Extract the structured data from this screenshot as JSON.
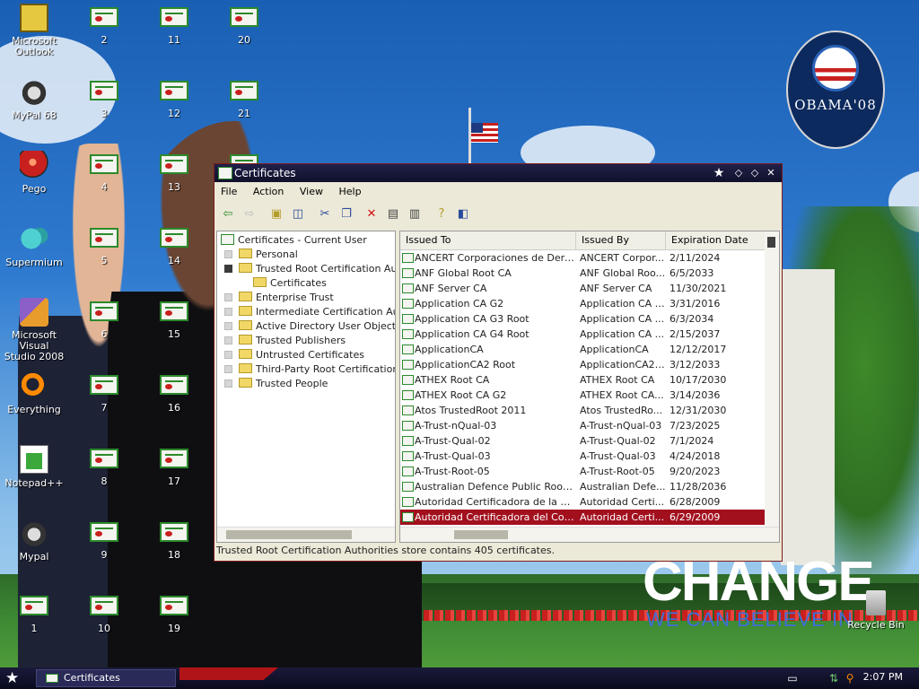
{
  "desktop": {
    "apps": [
      {
        "label": "Microsoft\nOutlook",
        "icon": "outlook-icon"
      },
      {
        "label": "MyPal 68",
        "icon": "raccoon-icon"
      },
      {
        "label": "Pego",
        "icon": "pego-icon"
      },
      {
        "label": "Supermium",
        "icon": "supermium-icon"
      },
      {
        "label": "Microsoft Visual\nStudio 2008",
        "icon": "visual-studio-icon"
      },
      {
        "label": "Everything",
        "icon": "search-icon"
      },
      {
        "label": "Notepad++",
        "icon": "notepad-icon"
      },
      {
        "label": "Mypal",
        "icon": "raccoon-icon"
      },
      {
        "label": "1",
        "icon": "certificate-icon"
      }
    ],
    "cert_icons": [
      "2",
      "3",
      "4",
      "5",
      "6",
      "7",
      "8",
      "9",
      "10",
      "11",
      "12",
      "13",
      "14",
      "15",
      "16",
      "17",
      "18",
      "19",
      "20",
      "21"
    ],
    "recycle_bin": "Recycle Bin",
    "wallpaper": {
      "logo_text": "OBAMA'08",
      "headline": "CHANGE",
      "tagline": "WE CAN BELIEVE IN"
    }
  },
  "window": {
    "title": "Certificates",
    "menu": [
      "File",
      "Action",
      "View",
      "Help"
    ],
    "toolbar_icons": [
      "back-icon",
      "forward-icon",
      "up-folder-icon",
      "show-hide-tree-icon",
      "cut-icon",
      "copy-icon",
      "delete-icon",
      "properties-icon",
      "export-icon",
      "help-icon",
      "console-icon"
    ],
    "tree": {
      "root": "Certificates - Current User",
      "items": [
        {
          "label": "Personal",
          "level": 1,
          "expander": "plus"
        },
        {
          "label": "Trusted Root Certification Authorities",
          "level": 1,
          "expander": "minus"
        },
        {
          "label": "Certificates",
          "level": 2,
          "expander": "none"
        },
        {
          "label": "Enterprise Trust",
          "level": 1,
          "expander": "plus"
        },
        {
          "label": "Intermediate Certification Authorities",
          "level": 1,
          "expander": "plus"
        },
        {
          "label": "Active Directory User Object",
          "level": 1,
          "expander": "plus"
        },
        {
          "label": "Trusted Publishers",
          "level": 1,
          "expander": "plus"
        },
        {
          "label": "Untrusted Certificates",
          "level": 1,
          "expander": "plus"
        },
        {
          "label": "Third-Party Root Certification Authorities",
          "level": 1,
          "expander": "plus"
        },
        {
          "label": "Trusted People",
          "level": 1,
          "expander": "plus"
        }
      ]
    },
    "columns": [
      "Issued To",
      "Issued By",
      "Expiration Date"
    ],
    "rows": [
      [
        "ANCERT Corporaciones de Derecho Publico",
        "ANCERT Corporaciones de Derecho Publico",
        "2/11/2024"
      ],
      [
        "ANF Global Root CA",
        "ANF Global Root CA",
        "6/5/2033"
      ],
      [
        "ANF Server CA",
        "ANF Server CA",
        "11/30/2021"
      ],
      [
        "Application CA G2",
        "Application CA G2",
        "3/31/2016"
      ],
      [
        "Application CA G3 Root",
        "Application CA G3 Root",
        "6/3/2034"
      ],
      [
        "Application CA G4 Root",
        "Application CA G4 Root",
        "2/15/2037"
      ],
      [
        "ApplicationCA",
        "ApplicationCA",
        "12/12/2017"
      ],
      [
        "ApplicationCA2 Root",
        "ApplicationCA2 Root",
        "3/12/2033"
      ],
      [
        "ATHEX Root CA",
        "ATHEX Root CA",
        "10/17/2030"
      ],
      [
        "ATHEX Root CA G2",
        "ATHEX Root CA G2",
        "3/14/2036"
      ],
      [
        "Atos TrustedRoot 2011",
        "Atos TrustedRoot 2011",
        "12/31/2030"
      ],
      [
        "A-Trust-nQual-03",
        "A-Trust-nQual-03",
        "7/23/2025"
      ],
      [
        "A-Trust-Qual-02",
        "A-Trust-Qual-02",
        "7/1/2024"
      ],
      [
        "A-Trust-Qual-03",
        "A-Trust-Qual-03",
        "4/24/2018"
      ],
      [
        "A-Trust-Root-05",
        "A-Trust-Root-05",
        "9/20/2023"
      ],
      [
        "Australian Defence Public Root CA",
        "Australian Defence Public Root CA",
        "11/28/2036"
      ],
      [
        "Autoridad Certificadora de la Asociacion Nacional del Notariado Mexicano",
        "Autoridad Certificadora de la Asociacion Nacional del Notariado Mexicano",
        "6/28/2009"
      ],
      [
        "Autoridad Certificadora del Colegio Nacional de Correduria Publica Mexicana",
        "Autoridad Certificadora del Colegio Nacional de Correduria Publica Mexicana",
        "6/29/2009"
      ]
    ],
    "selected_row": 17,
    "display_rows": [
      [
        "ANCERT Corporaciones de Derech...",
        "ANCERT Corpor...",
        "2/11/2024"
      ],
      [
        "ANF Global Root CA",
        "ANF Global Roo...",
        "6/5/2033"
      ],
      [
        "ANF Server CA",
        "ANF Server CA",
        "11/30/2021"
      ],
      [
        "Application CA G2",
        "Application CA G2",
        "3/31/2016"
      ],
      [
        "Application CA G3 Root",
        "Application CA ...",
        "6/3/2034"
      ],
      [
        "Application CA G4 Root",
        "Application CA ...",
        "2/15/2037"
      ],
      [
        "ApplicationCA",
        "ApplicationCA",
        "12/12/2017"
      ],
      [
        "ApplicationCA2 Root",
        "ApplicationCA2 ...",
        "3/12/2033"
      ],
      [
        "ATHEX Root CA",
        "ATHEX Root CA",
        "10/17/2030"
      ],
      [
        "ATHEX Root CA G2",
        "ATHEX Root CA...",
        "3/14/2036"
      ],
      [
        "Atos TrustedRoot 2011",
        "Atos TrustedRo...",
        "12/31/2030"
      ],
      [
        "A-Trust-nQual-03",
        "A-Trust-nQual-03",
        "7/23/2025"
      ],
      [
        "A-Trust-Qual-02",
        "A-Trust-Qual-02",
        "7/1/2024"
      ],
      [
        "A-Trust-Qual-03",
        "A-Trust-Qual-03",
        "4/24/2018"
      ],
      [
        "A-Trust-Root-05",
        "A-Trust-Root-05",
        "9/20/2023"
      ],
      [
        "Australian Defence Public Root CA",
        "Australian Defe...",
        "11/28/2036"
      ],
      [
        "Autoridad Certificadora de la Asoc...",
        "Autoridad Certi...",
        "6/28/2009"
      ],
      [
        "Autoridad Certificadora del Colegi...",
        "Autoridad Certi...",
        "6/29/2009"
      ]
    ],
    "status_text": "Trusted Root Certification Authorities store contains 405 certificates."
  },
  "taskbar": {
    "start_icon": "star-icon",
    "task_label": "Certificates",
    "clock": "2:07 PM",
    "tray_icons": [
      "keyboard-icon",
      "network-icon",
      "search-icon"
    ]
  },
  "colors": {
    "selection": "#a2101e",
    "window_border": "#7f1b1b",
    "titlebar": "#11112b"
  }
}
